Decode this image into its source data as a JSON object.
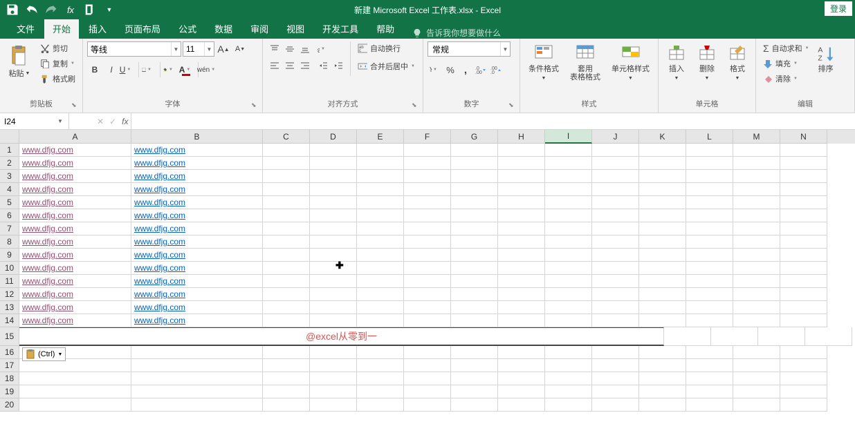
{
  "app": {
    "title": "新建 Microsoft Excel 工作表.xlsx - Excel",
    "login": "登录"
  },
  "tabs": {
    "file": "文件",
    "home": "开始",
    "insert": "插入",
    "layout": "页面布局",
    "formulas": "公式",
    "data": "数据",
    "review": "审阅",
    "view": "视图",
    "dev": "开发工具",
    "help": "帮助",
    "tellme": "告诉我你想要做什么"
  },
  "ribbon": {
    "clipboard": {
      "paste": "粘贴",
      "cut": "剪切",
      "copy": "复制",
      "painter": "格式刷",
      "group": "剪贴板"
    },
    "font": {
      "name": "等线",
      "size": "11",
      "bold": "B",
      "italic": "I",
      "underline": "U",
      "ruby": "wén",
      "group": "字体"
    },
    "alignment": {
      "wrap": "自动换行",
      "merge": "合并后居中",
      "group": "对齐方式"
    },
    "number": {
      "format": "常规",
      "group": "数字"
    },
    "styles": {
      "cond": "条件格式",
      "table": "套用\n表格格式",
      "cell": "单元格样式",
      "group": "样式"
    },
    "cells": {
      "insert": "插入",
      "delete": "删除",
      "format": "格式",
      "group": "单元格"
    },
    "editing": {
      "sum": "自动求和",
      "fill": "填充",
      "clear": "清除",
      "sort": "排序",
      "group": "编辑"
    }
  },
  "nameBox": "I24",
  "columns": [
    "A",
    "B",
    "C",
    "D",
    "E",
    "F",
    "G",
    "H",
    "I",
    "J",
    "K",
    "L",
    "M",
    "N"
  ],
  "rows": [
    {
      "n": 1,
      "a": "www.dfjg.com",
      "b": "www.dfjg.com"
    },
    {
      "n": 2,
      "a": "www.dfjg.com",
      "b": "www.dfjg.com"
    },
    {
      "n": 3,
      "a": "www.dfjg.com",
      "b": "www.dfjg.com"
    },
    {
      "n": 4,
      "a": "www.dfjg.com",
      "b": "www.dfjg.com"
    },
    {
      "n": 5,
      "a": "www.dfjg.com",
      "b": "www.dfjg.com"
    },
    {
      "n": 6,
      "a": "www.dfjg.com",
      "b": "www.dfjg.com"
    },
    {
      "n": 7,
      "a": "www.dfjg.com",
      "b": "www.dfjg.com"
    },
    {
      "n": 8,
      "a": "www.dfjg.com",
      "b": "www.dfjg.com"
    },
    {
      "n": 9,
      "a": "www.dfjg.com",
      "b": "www.dfjg.com"
    },
    {
      "n": 10,
      "a": "www.dfjg.com",
      "b": "www.dfjg.com"
    },
    {
      "n": 11,
      "a": "www.dfjg.com",
      "b": "www.dfjg.com"
    },
    {
      "n": 12,
      "a": "www.dfjg.com",
      "b": "www.dfjg.com"
    },
    {
      "n": 13,
      "a": "www.dfjg.com",
      "b": "www.dfjg.com"
    },
    {
      "n": 14,
      "a": "www.dfjg.com",
      "b": "www.dfjg.com"
    }
  ],
  "mergedText": "@excel从零到一",
  "extraRows": [
    16,
    17,
    18,
    19,
    20
  ],
  "pasteOptions": "(Ctrl)"
}
